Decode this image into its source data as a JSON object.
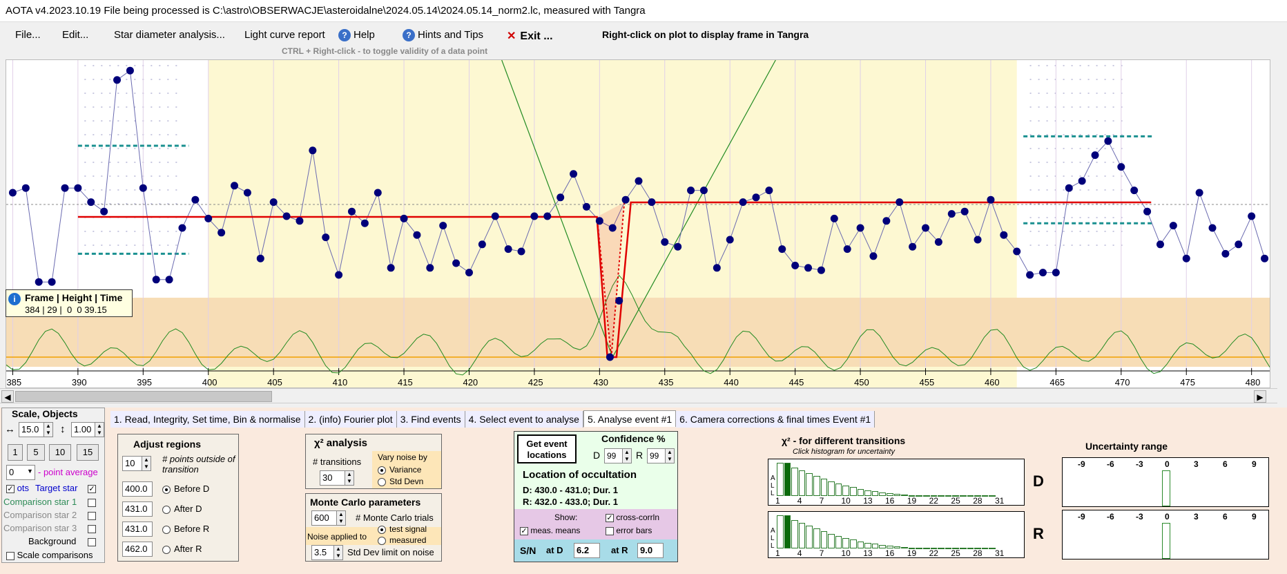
{
  "title_bar": {
    "text": "AOTA v4.2023.10.19    File being processed is C:\\astro\\OBSERWACJE\\asteroidalne\\2024.05.14\\2024.05.14_norm2.lc, measured with Tangra"
  },
  "menu": {
    "file": "File...",
    "edit": "Edit...",
    "star_diameter": "Star diameter analysis...",
    "light_curve_report": "Light curve report",
    "help": "Help",
    "hints": "Hints and Tips",
    "exit": "Exit ...",
    "exit_symbol": "✕",
    "help_symbol": "?",
    "right_click_hint": "Right-click on plot to display frame in Tangra",
    "ctrl_hint": "CTRL + Right-click  -  to toggle validity of a data point"
  },
  "plot": {
    "x_ticks": [
      "385",
      "390",
      "395",
      "400",
      "405",
      "410",
      "415",
      "420",
      "425",
      "430",
      "435",
      "440",
      "445",
      "450",
      "455",
      "460",
      "465",
      "470",
      "475",
      "480"
    ],
    "frame_start": 384.5,
    "frame_end": 481.5,
    "colors": {
      "point": "#00007a",
      "line": "#6a6ab0",
      "fit": "#e00000",
      "green": "#228b22",
      "orange": "#f0a000",
      "yellow_bg": "#fdf8d2",
      "tan_bg": "#f7ddb6"
    },
    "points": [
      [
        385,
        0.7
      ],
      [
        386,
        0.72
      ],
      [
        387,
        0.32
      ],
      [
        388,
        0.32
      ],
      [
        389,
        0.72
      ],
      [
        390,
        0.72
      ],
      [
        391,
        0.66
      ],
      [
        392,
        0.62
      ],
      [
        393,
        1.18
      ],
      [
        394,
        1.22
      ],
      [
        395,
        0.72
      ],
      [
        396,
        0.33
      ],
      [
        397,
        0.33
      ],
      [
        398,
        0.55
      ],
      [
        399,
        0.67
      ],
      [
        400,
        0.59
      ],
      [
        401,
        0.53
      ],
      [
        402,
        0.73
      ],
      [
        403,
        0.7
      ],
      [
        404,
        0.42
      ],
      [
        405,
        0.66
      ],
      [
        406,
        0.6
      ],
      [
        407,
        0.58
      ],
      [
        408,
        0.88
      ],
      [
        409,
        0.51
      ],
      [
        410,
        0.35
      ],
      [
        411,
        0.62
      ],
      [
        412,
        0.57
      ],
      [
        413,
        0.7
      ],
      [
        414,
        0.38
      ],
      [
        415,
        0.59
      ],
      [
        416,
        0.52
      ],
      [
        417,
        0.38
      ],
      [
        418,
        0.56
      ],
      [
        419,
        0.4
      ],
      [
        420,
        0.36
      ],
      [
        421,
        0.48
      ],
      [
        422,
        0.6
      ],
      [
        423,
        0.46
      ],
      [
        424,
        0.45
      ],
      [
        425,
        0.6
      ],
      [
        426,
        0.6
      ],
      [
        427,
        0.68
      ],
      [
        428,
        0.78
      ],
      [
        429,
        0.64
      ],
      [
        430,
        0.58
      ],
      [
        431,
        0.55
      ],
      [
        432,
        0.67
      ],
      [
        433,
        0.75
      ],
      [
        434,
        0.66
      ],
      [
        435,
        0.49
      ],
      [
        436,
        0.47
      ],
      [
        437,
        0.71
      ],
      [
        438,
        0.71
      ],
      [
        439,
        0.38
      ],
      [
        440,
        0.5
      ],
      [
        441,
        0.66
      ],
      [
        442,
        0.68
      ],
      [
        443,
        0.71
      ],
      [
        444,
        0.46
      ],
      [
        445,
        0.39
      ],
      [
        446,
        0.38
      ],
      [
        447,
        0.37
      ],
      [
        448,
        0.59
      ],
      [
        449,
        0.46
      ],
      [
        450,
        0.55
      ],
      [
        451,
        0.43
      ],
      [
        452,
        0.58
      ],
      [
        453,
        0.66
      ],
      [
        454,
        0.47
      ],
      [
        455,
        0.55
      ],
      [
        456,
        0.49
      ],
      [
        457,
        0.61
      ],
      [
        458,
        0.62
      ],
      [
        459,
        0.5
      ],
      [
        460,
        0.67
      ],
      [
        461,
        0.52
      ],
      [
        462,
        0.45
      ],
      [
        463,
        0.35
      ],
      [
        464,
        0.36
      ],
      [
        465,
        0.36
      ],
      [
        466,
        0.72
      ],
      [
        467,
        0.75
      ],
      [
        468,
        0.86
      ],
      [
        469,
        0.92
      ],
      [
        470,
        0.81
      ],
      [
        471,
        0.71
      ],
      [
        472,
        0.62
      ],
      [
        473,
        0.48
      ],
      [
        474,
        0.56
      ],
      [
        475,
        0.42
      ],
      [
        476,
        0.7
      ],
      [
        477,
        0.55
      ],
      [
        478,
        0.44
      ],
      [
        479,
        0.48
      ],
      [
        480,
        0.6
      ],
      [
        481,
        0.42
      ]
    ],
    "baseline_level": 0.65,
    "event_level": 0.0,
    "d_edge": 430.5,
    "r_edge": 432.5
  },
  "info_box": {
    "header": "Frame | Height | Time",
    "values": "384 | 29 |  0  0 39.15",
    "icon": "i"
  },
  "tabs": [
    "1.  Read, Integrity, Set time, Bin & normalise",
    "2. (info)  Fourier plot",
    "3. Find events",
    "4. Select event to analyse",
    "5. Analyse event #1",
    "6. Camera corrections & final times Event #1"
  ],
  "scale_objects": {
    "title": "Scale, Objects",
    "h_arrow": "↔",
    "v_arrow": "↕",
    "h_scale": "15.0",
    "v_scale": "1.00",
    "buttons": [
      "1",
      "5",
      "10",
      "15"
    ],
    "point_avg_value": "0",
    "point_avg_label": "- point average",
    "dots_label": "ots",
    "target_label": "Target star",
    "comp1": "Comparison star 1",
    "comp2": "Comparison star 2",
    "comp3": "Comparison star 3",
    "background": "Background",
    "scale_comparisons": "Scale comparisons",
    "colors": {
      "target": "#0000cc",
      "comp1": "#2e8b57",
      "comp2": "#888888",
      "comp3": "#888888",
      "avg": "#cc00cc"
    }
  },
  "adjust_regions": {
    "title": "Adjust regions",
    "points_outside_value": "10",
    "points_outside_label": "# points outside of transition",
    "rows": [
      {
        "value": "400.0",
        "label": "Before D"
      },
      {
        "value": "431.0",
        "label": "After D"
      },
      {
        "value": "431.0",
        "label": "Before R"
      },
      {
        "value": "462.0",
        "label": "After R"
      }
    ]
  },
  "chi_analysis": {
    "title": "χ² analysis",
    "transitions_label": "# transitions",
    "transitions_value": "30",
    "vary_noise_label": "Vary noise by",
    "variance": "Variance",
    "std_devn": "Std Devn"
  },
  "monte_carlo": {
    "title": "Monte Carlo parameters",
    "trials_value": "600",
    "trials_label": "# Monte Carlo trials",
    "noise_applied_label": "Noise applied to",
    "test_signal": "test signal",
    "measured": "measured",
    "std_dev_value": "3.5",
    "std_dev_label": "Std Dev limit on noise"
  },
  "event_locations": {
    "button": "Get event locations",
    "confidence_title": "Confidence %",
    "d_label": "D",
    "r_label": "R",
    "d_value": "99",
    "r_value": "99",
    "location_title": "Location of occultation",
    "d_line": "D: 430.0 - 431.0;  Dur. 1",
    "r_line": "R: 432.0 - 433.0;  Dur. 1",
    "show_label": "Show:",
    "cross_corr": "cross-corrln",
    "meas_means": "meas. means",
    "error_bars": "error bars",
    "sn_label": "S/N",
    "at_d_label": "at D",
    "at_d_value": "6.2",
    "at_r_label": "at R",
    "at_r_value": "9.0"
  },
  "histograms": {
    "title": "χ² - for different transitions",
    "subtitle": "Click histogram for uncertainty",
    "all_label": "A\nL\nL",
    "ticks": [
      "1",
      "4",
      "7",
      "10",
      "13",
      "16",
      "19",
      "22",
      "25",
      "28",
      "31"
    ],
    "d_label": "D",
    "r_label": "R",
    "bar_values": [
      0.96,
      0.96,
      0.83,
      0.74,
      0.66,
      0.58,
      0.5,
      0.43,
      0.37,
      0.31,
      0.26,
      0.21,
      0.17,
      0.14,
      0.11,
      0.08,
      0.06,
      0.04,
      0.03,
      0.02,
      0.015,
      0.01,
      0.008,
      0.006,
      0.005,
      0.004,
      0.003,
      0.002,
      0.002,
      0.001
    ],
    "highlight_index": 1
  },
  "uncertainty": {
    "title": "Uncertainty range",
    "ticks": [
      "-9",
      "-6",
      "-3",
      "0",
      "3",
      "6",
      "9"
    ]
  }
}
